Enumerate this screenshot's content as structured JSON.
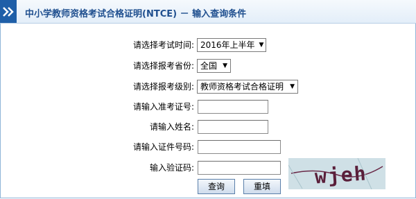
{
  "header": {
    "title": "中小学教师资格考试合格证明(NTCE) － 输入查询条件",
    "icon": "double-chevron-right-icon"
  },
  "form": {
    "exam_time": {
      "label": "请选择考试时间:",
      "value": "2016年上半年"
    },
    "province": {
      "label": "请选择报考省份:",
      "value": "全国"
    },
    "level": {
      "label": "请选择报考级别:",
      "value": "教师资格考试合格证明"
    },
    "admission_no": {
      "label": "请输入准考证号:",
      "value": ""
    },
    "name": {
      "label": "请输入姓名:",
      "value": ""
    },
    "id_no": {
      "label": "请输入证件号码:",
      "value": ""
    },
    "captcha": {
      "label": "输入验证码:",
      "value": "",
      "image_text": "wjeh"
    }
  },
  "buttons": {
    "query": "查询",
    "reset": "重填"
  }
}
